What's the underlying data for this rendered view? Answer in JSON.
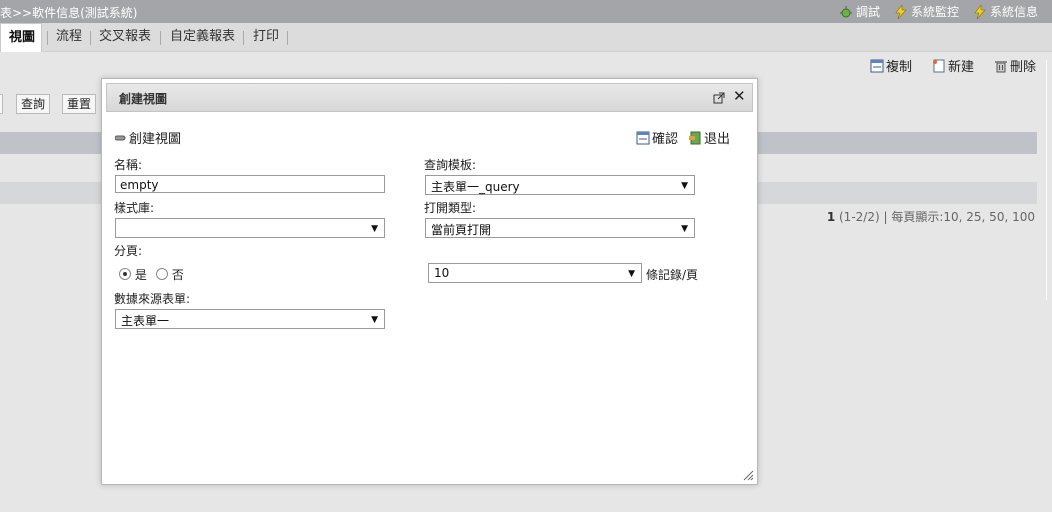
{
  "topbar": {
    "title": "表>>軟件信息(測試系統)",
    "links": [
      {
        "label": "調試",
        "icon": "bug-icon"
      },
      {
        "label": "系統監控",
        "icon": "lightning-icon"
      },
      {
        "label": "系統信息",
        "icon": "lightning-icon"
      }
    ]
  },
  "tabs": [
    "視圖",
    "流程",
    "交叉報表",
    "自定義報表",
    "打印"
  ],
  "toolbar": {
    "copy": "複制",
    "new": "新建",
    "delete": "刪除"
  },
  "bg_buttons": {
    "query": "查詢",
    "reset": "重置"
  },
  "pager": {
    "page": "1",
    "range": "(1-2/2)",
    "sep": "|",
    "per_page": "每頁顯示:10, 25, 50, 100"
  },
  "dialog": {
    "title": "創建視圖",
    "subtitle": "創建視圖",
    "confirm": "確認",
    "exit": "退出",
    "name_label": "名稱:",
    "name_value": "empty",
    "query_label": "查詢模板:",
    "query_value": "主表單一_query",
    "style_label": "樣式庫:",
    "style_value": "",
    "open_label": "打開類型:",
    "open_value": "當前頁打開",
    "paging_label": "分頁:",
    "paging_yes": "是",
    "paging_no": "否",
    "page_size": "10",
    "page_size_unit": "條記錄/頁",
    "source_label": "數據來源表單:",
    "source_value": "主表單一"
  },
  "colors": {
    "topbar": "#a3a5a8",
    "tabbar": "#dcdcdc",
    "band": "#bfc3c9"
  }
}
